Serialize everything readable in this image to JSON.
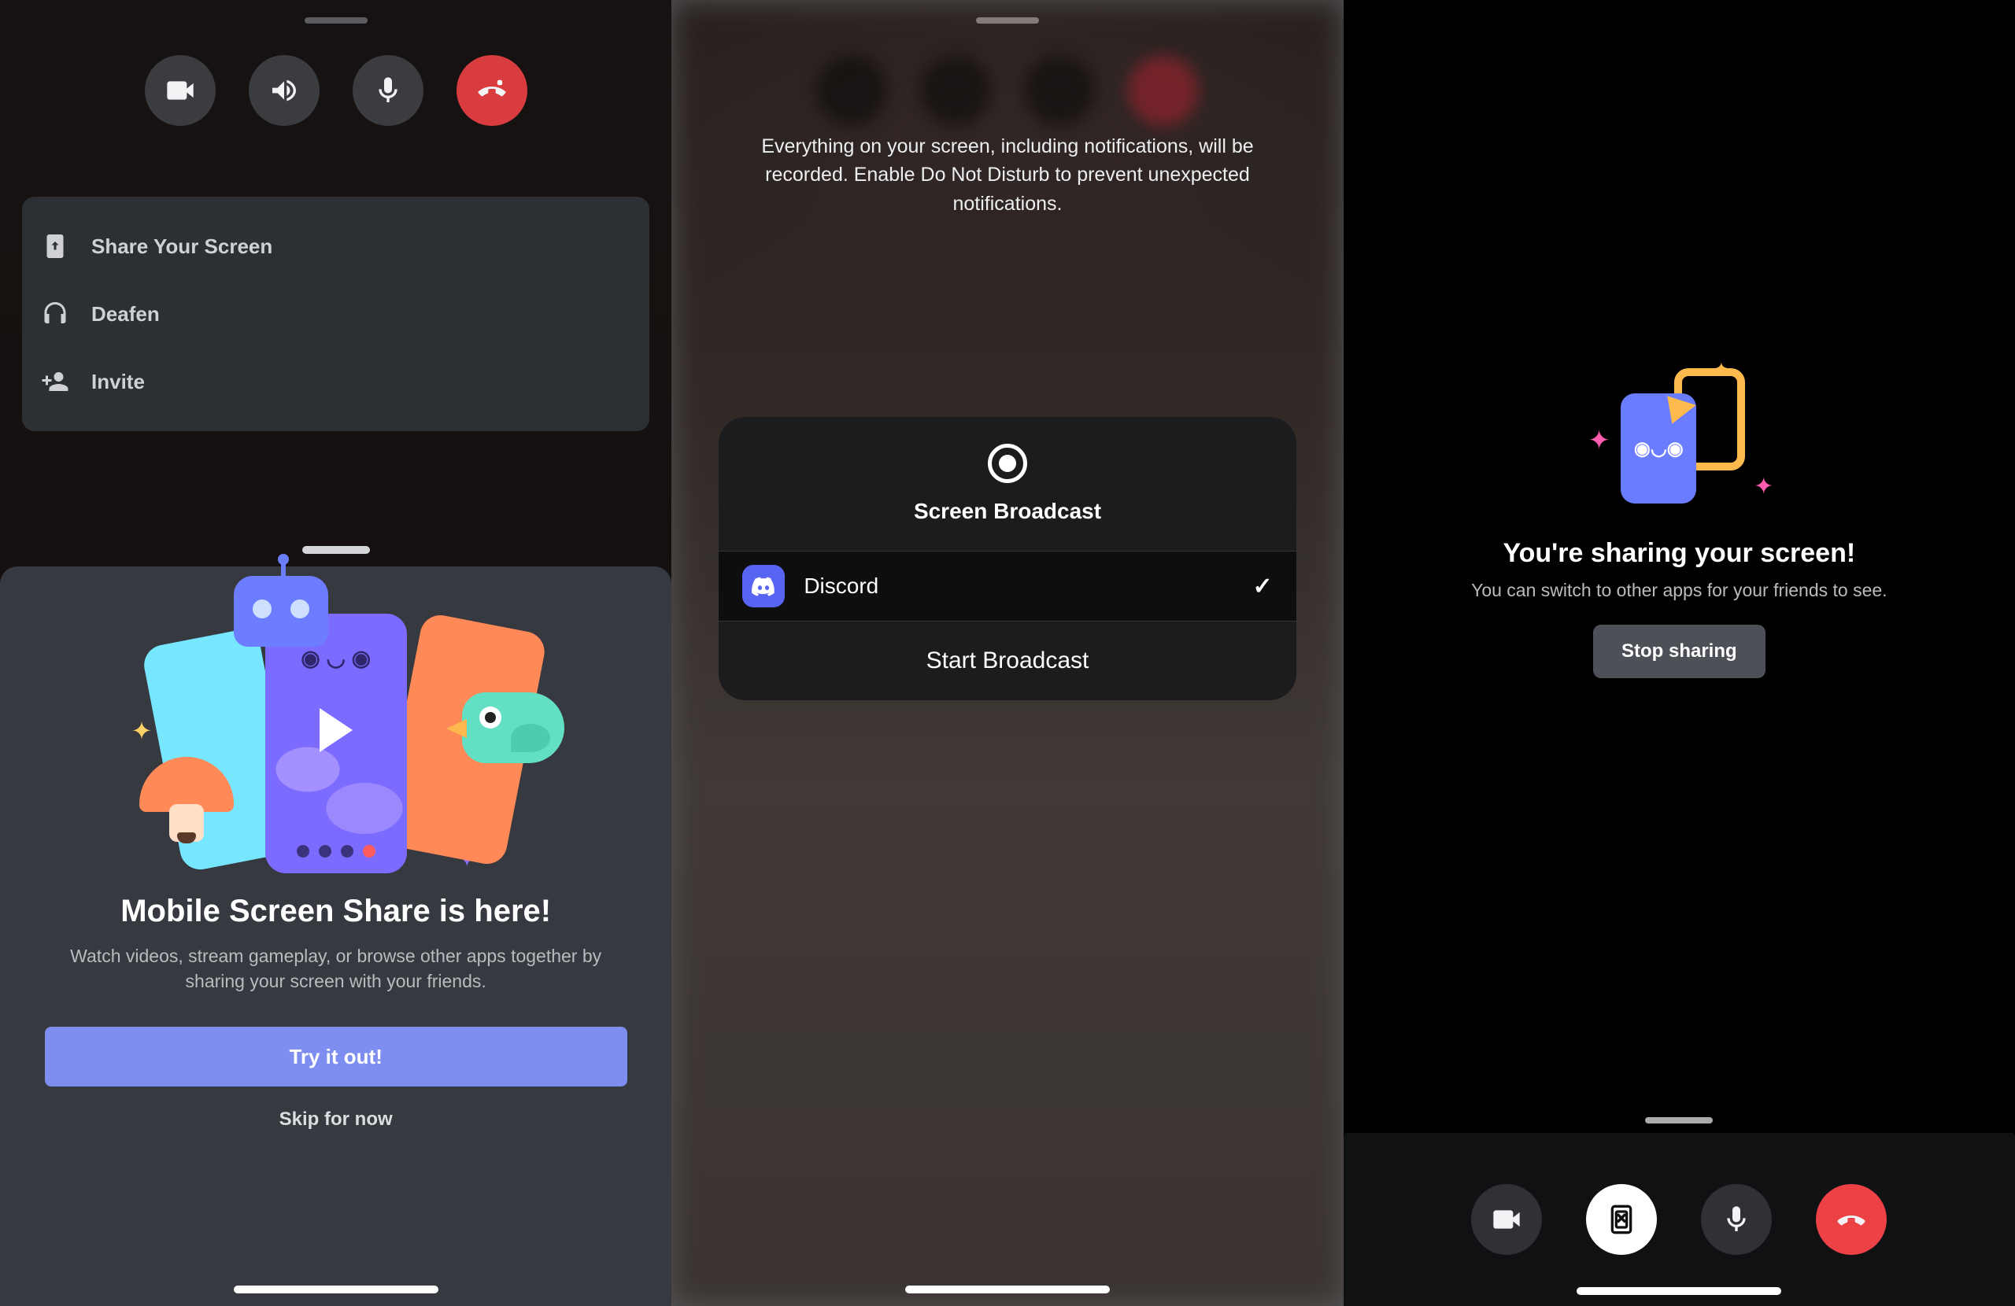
{
  "colors": {
    "blurple": "#5865f2",
    "blurple_light": "#7d8ef0",
    "red": "#ed4245",
    "orange": "#ff8a58",
    "yellow": "#ffba4d",
    "card": "#2c2f33",
    "sheet": "#36393f",
    "footer_btn": "#2f3136",
    "stop_btn": "#4e5058"
  },
  "phone1": {
    "call_controls": {
      "video": "video",
      "speaker": "speaker",
      "mic": "microphone",
      "hangup": "hang-up"
    },
    "menu": {
      "share_screen": "Share Your Screen",
      "deafen": "Deafen",
      "invite": "Invite"
    },
    "promo": {
      "title": "Mobile Screen Share is here!",
      "desc": "Watch videos, stream gameplay, or browse other apps together by sharing your screen with your friends.",
      "primary_btn": "Try it out!",
      "skip": "Skip for now"
    }
  },
  "phone2": {
    "notice": "Everything on your screen, including notifications, will be recorded. Enable Do Not Disturb to prevent unexpected notifications.",
    "panel": {
      "title": "Screen Broadcast",
      "app_name": "Discord",
      "selected": true,
      "action": "Start Broadcast"
    }
  },
  "phone3": {
    "title": "You're sharing your screen!",
    "desc": "You can switch to other apps for your friends to see.",
    "stop_btn": "Stop sharing",
    "footer_controls": {
      "video": "video",
      "stop_share": "stop-screen-share",
      "mic": "microphone",
      "hangup": "hang-up"
    }
  }
}
